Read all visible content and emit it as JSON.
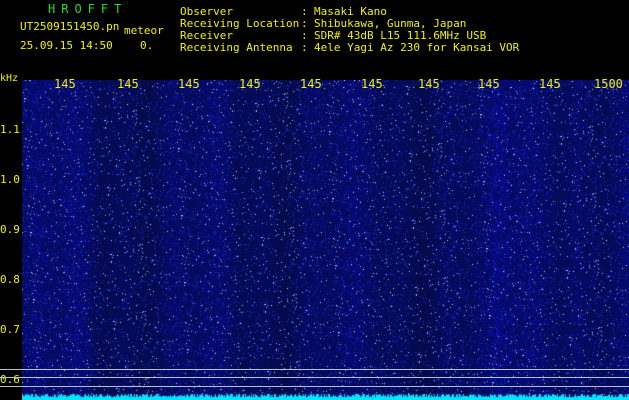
{
  "header": {
    "brand": "HROFFT",
    "filename": "UT2509151450.pn",
    "mode": "meteor",
    "datetime": "25.09.15 14:50",
    "count": "0.",
    "info": [
      {
        "key": "Observer",
        "value": "Masaki Kano"
      },
      {
        "key": "Receiving Location",
        "value": "Shibukawa, Gunma, Japan"
      },
      {
        "key": "Receiver",
        "value": "SDR# 43dB L15 111.6MHz USB"
      },
      {
        "key": "Receiving Antenna",
        "value": "4ele Yagi Az 230 for Kansai VOR"
      }
    ]
  },
  "spectrogram": {
    "y_unit": "kHz",
    "x_ticks": [
      "145",
      "145",
      "145",
      "145",
      "145",
      "145",
      "145",
      "145",
      "145",
      "1500"
    ],
    "y_ticks": [
      "1.1",
      "1.0",
      "0.9",
      "0.8",
      "0.7",
      "0.6"
    ]
  },
  "colors": {
    "text": "#f2f200",
    "brand": "#22dd22",
    "background": "#0a0f4a",
    "noise": "#2a3cff",
    "baseline": "#00e5ff"
  }
}
